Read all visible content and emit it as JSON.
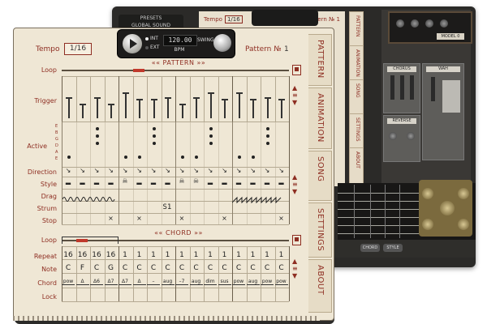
{
  "back": {
    "presets_title": "PRESETS",
    "presets_sub": "GLOBAL  SOUND",
    "tempo_label": "Tempo",
    "tempo_value": "1/16",
    "pattern_label": "Pattern №",
    "pattern_value": "1",
    "tabs": [
      "PATTERN",
      "ANIMATION",
      "SONG",
      "SETTINGS",
      "ABOUT"
    ],
    "amp_model": "MODEL 0",
    "fx": [
      "CHORUS",
      "WAH",
      "REVERSE"
    ],
    "fx_labels": [
      "FX1",
      "FX2"
    ],
    "bottom_buttons": [
      "CHORD",
      "STYLE"
    ]
  },
  "front": {
    "tempo_label": "Tempo",
    "tempo_value": "1/16",
    "pattern_label": "Pattern №",
    "pattern_value": "1",
    "transport": {
      "int": "INT",
      "ext": "EXT",
      "bpm_value": "120.00",
      "bpm_label": "BPM",
      "swing": "SWING"
    },
    "tabs": [
      "PATTERN",
      "ANIMATION",
      "SONG",
      "SETTINGS",
      "ABOUT"
    ],
    "pattern_header": "PATTERN",
    "chord_header": "CHORD",
    "rows": {
      "loop": "Loop",
      "trigger": "Trigger",
      "active": "Active",
      "direction": "Direction",
      "style": "Style",
      "drag": "Drag",
      "strum": "Strum",
      "stop": "Stop",
      "loop2": "Loop",
      "repeat": "Repeat",
      "note": "Note",
      "chord": "Chord",
      "lock": "Lock"
    },
    "string_letters": [
      "E",
      "B",
      "G",
      "D",
      "A",
      "E"
    ],
    "trigger_heights": [
      0.66,
      0.46,
      0.66,
      0.46,
      0.8,
      0.6,
      0.6,
      0.66,
      0.46,
      0.66,
      0.8,
      0.6,
      0.8,
      0.6,
      0.66,
      0.6
    ],
    "strum_text": "S1",
    "repeat": [
      "16",
      "16",
      "16",
      "16",
      "1",
      "1",
      "1",
      "1",
      "1",
      "1",
      "1",
      "1",
      "1",
      "1",
      "1",
      "1"
    ],
    "notes": [
      "C",
      "F",
      "C",
      "G",
      "C",
      "C",
      "C",
      "C",
      "C",
      "C",
      "C",
      "C",
      "C",
      "C",
      "C",
      "C"
    ],
    "chords": [
      "pow",
      "Δ",
      "Δ6",
      "Δ7",
      "Δ7",
      "Δ",
      "–",
      "aug",
      "–7",
      "aug",
      "dim",
      "sus",
      "pow",
      "aug",
      "pow",
      "pow"
    ]
  }
}
